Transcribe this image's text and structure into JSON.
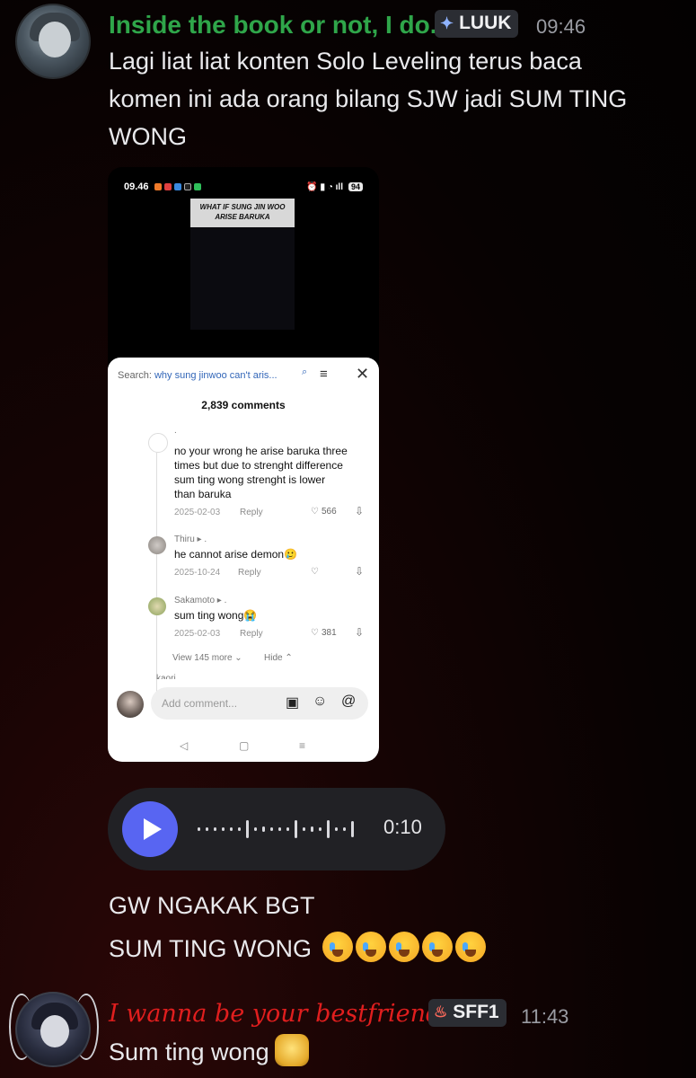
{
  "message1": {
    "username": "Inside the book or not, I do.",
    "tag": "LUUK",
    "time": "09:46",
    "text_lines": [
      "Lagi liat liat konten Solo Leveling terus baca",
      "komen ini ada orang bilang SJW jadi SUM TING",
      "WONG"
    ]
  },
  "screenshot": {
    "status_time": "09.46",
    "battery": "94",
    "video_title": "WHAT IF SUNG JIN WOO ARISE BARUKA",
    "search_label": "Search:",
    "search_query": "why sung jinwoo can't aris...",
    "comment_count": "2,839 comments",
    "comments": [
      {
        "user": ".",
        "text_lines": [
          "no your wrong he arise baruka three",
          "times but due to strenght difference",
          "sum ting wong strenght is lower",
          "than baruka"
        ],
        "date": "2025-02-03",
        "reply": "Reply",
        "likes": "566"
      },
      {
        "user": "Thiru ▸ .",
        "text_lines": [
          "he cannot arise demon🥲"
        ],
        "date": "2025-10-24",
        "reply": "Reply",
        "likes": ""
      },
      {
        "user": "Sakamoto ▸ .",
        "text_lines": [
          "sum ting wong😭"
        ],
        "date": "2025-02-03",
        "reply": "Reply",
        "likes": "381"
      }
    ],
    "view_more": "View 145 more ⌄",
    "hide": "Hide ⌃",
    "partial_user": "kaori",
    "input_placeholder": "Add comment..."
  },
  "voice": {
    "duration": "0:10"
  },
  "message1_followup": {
    "lines": [
      "GW NGAKAK BGT",
      "SUM TING WONG"
    ]
  },
  "message2": {
    "username": "I wanna be your bestfriend",
    "tag": "SFF1",
    "time": "11:43",
    "text": "Sum ting wong"
  },
  "colors": {
    "username1": "#2fa64a",
    "username2": "#e01e1e",
    "play_button": "#5865f2"
  },
  "icons": [
    "avatar-1",
    "diamond-tag-icon",
    "flame-tag-icon",
    "play-icon",
    "search-icon",
    "sort-icon",
    "close-icon",
    "heart-icon",
    "dislike-icon",
    "image-icon",
    "sticker-icon",
    "mention-icon"
  ]
}
